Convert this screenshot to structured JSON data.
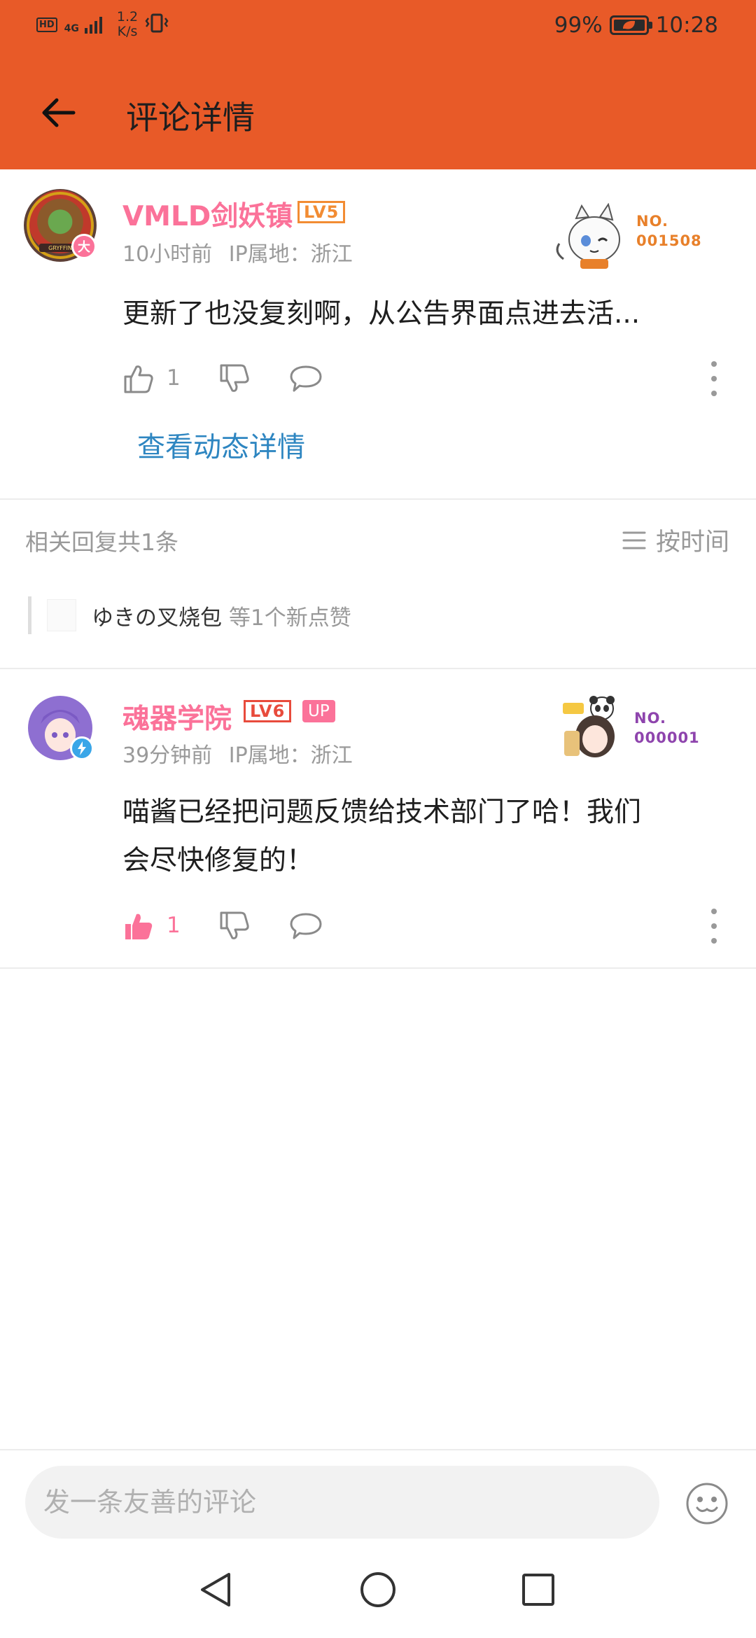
{
  "status_bar": {
    "hd": "HD",
    "network": "4G",
    "speed_value": "1.2",
    "speed_unit": "K/s",
    "battery": "99%",
    "time": "10:28"
  },
  "header": {
    "title": "评论详情",
    "back_icon": "arrow-left-icon"
  },
  "main_comment": {
    "username": "VMLD剑妖镇",
    "level": "LV5",
    "avatar_badge": "大",
    "time": "10小时前",
    "ip_location": "IP属地：浙江",
    "text": "更新了也没复刻啊，从公告界面点进去活...",
    "likes": "1",
    "fan_no_label": "NO.",
    "fan_no": "001508",
    "view_detail": "查看动态详情",
    "level_color": "#F28C33"
  },
  "replies_section": {
    "count_text": "相关回复共1条",
    "sort_label": "按时间",
    "likers_name": "ゆきの叉烧包",
    "likers_suffix": "等1个新点赞"
  },
  "reply": {
    "username": "魂器学院",
    "level": "LV6",
    "up_tag": "UP",
    "time": "39分钟前",
    "ip_location": "IP属地：浙江",
    "text_line1": "喵酱已经把问题反馈给技术部门了哈！我们",
    "text_line2": "会尽快修复的！",
    "likes": "1",
    "liked": true,
    "fan_no_label": "NO.",
    "fan_no": "000001",
    "level_color": "#E84B3C"
  },
  "input": {
    "placeholder": "发一条友善的评论"
  },
  "colors": {
    "header_bg": "#E85A28",
    "username": "#FB7299",
    "link": "#2E86C1",
    "liked": "#FB7299"
  }
}
